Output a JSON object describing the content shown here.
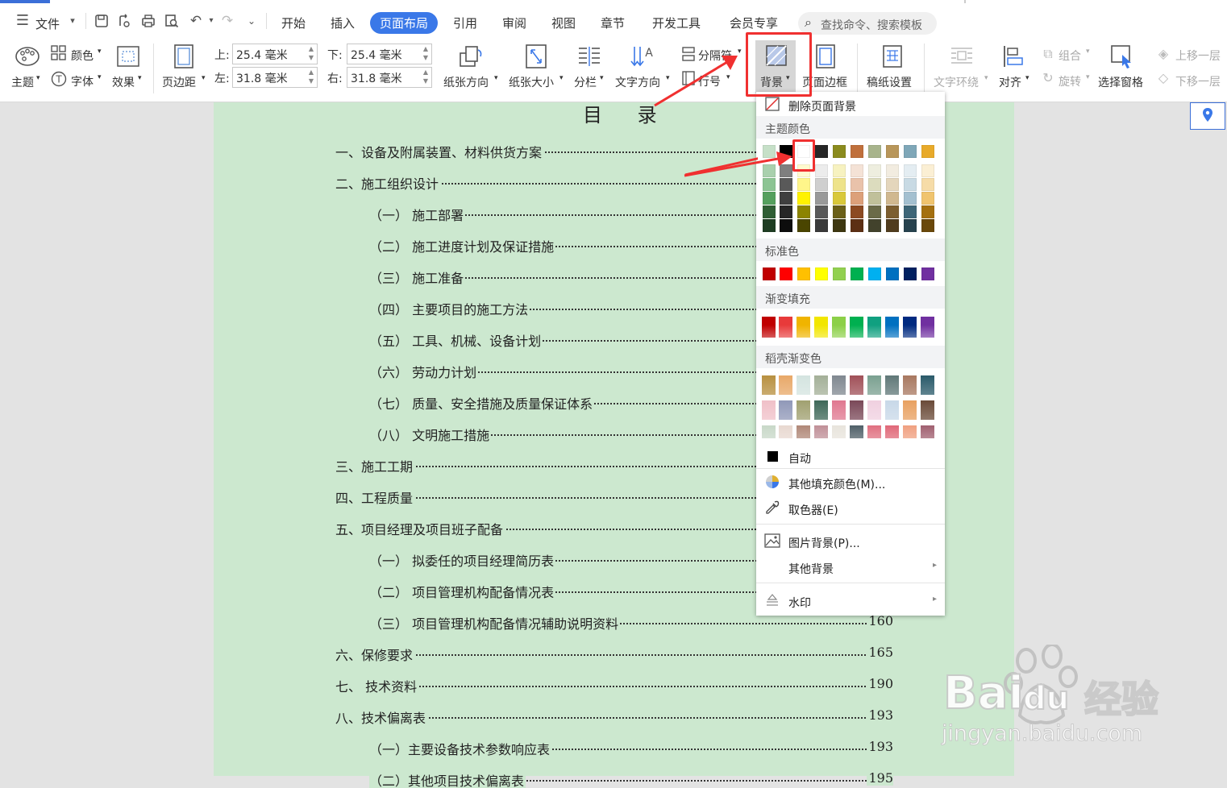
{
  "menubar": {
    "file_label": "文件",
    "tabs": [
      {
        "label": "开始",
        "active": false
      },
      {
        "label": "插入",
        "active": false
      },
      {
        "label": "页面布局",
        "active": true
      },
      {
        "label": "引用",
        "active": false
      },
      {
        "label": "审阅",
        "active": false
      },
      {
        "label": "视图",
        "active": false
      },
      {
        "label": "章节",
        "active": false
      },
      {
        "label": "开发工具",
        "active": false
      },
      {
        "label": "会员专享",
        "active": false
      }
    ],
    "search_placeholder": "查找命令、搜索模板"
  },
  "ribbon": {
    "theme_label": "主题",
    "color_label": "颜色",
    "font_label": "字体",
    "effect_label": "效果",
    "margin_label": "页边距",
    "top_label": "上:",
    "top_value": "25.4 毫米",
    "bottom_label": "下:",
    "bottom_value": "25.4 毫米",
    "left_label": "左:",
    "left_value": "31.8 毫米",
    "right_label": "右:",
    "right_value": "31.8 毫米",
    "orientation_label": "纸张方向",
    "size_label": "纸张大小",
    "columns_label": "分栏",
    "text_dir_label": "文字方向",
    "break_label": "分隔符",
    "line_num_label": "行号",
    "background_label": "背景",
    "border_label": "页面边框",
    "grid_paper_label": "稿纸设置",
    "wrap_label": "文字环绕",
    "align_label": "对齐",
    "group_label": "组合",
    "rotate_label": "旋转",
    "select_pane_label": "选择窗格",
    "bring_forward_label": "上移一层",
    "send_backward_label": "下移一层"
  },
  "document": {
    "title": "目  录",
    "toc": [
      {
        "text": "一、设备及附属装置、材料供货方案",
        "page": "",
        "indent": 0
      },
      {
        "text": "二、施工组织设计",
        "page": "",
        "indent": 0
      },
      {
        "text": "（一）  施工部署",
        "page": "",
        "indent": 1
      },
      {
        "text": "（二）  施工进度计划及保证措施",
        "page": "",
        "indent": 1
      },
      {
        "text": "（三）  施工准备",
        "page": "",
        "indent": 1
      },
      {
        "text": "（四）  主要项目的施工方法",
        "page": "",
        "indent": 1
      },
      {
        "text": "（五）  工具、机械、设备计划",
        "page": "",
        "indent": 1
      },
      {
        "text": "（六）  劳动力计划",
        "page": "",
        "indent": 1
      },
      {
        "text": "（七）  质量、安全措施及质量保证体系",
        "page": "",
        "indent": 1
      },
      {
        "text": "（八）  文明施工措施",
        "page": "",
        "indent": 1
      },
      {
        "text": "三、施工工期",
        "page": "",
        "indent": 0
      },
      {
        "text": "四、工程质量",
        "page": "",
        "indent": 0
      },
      {
        "text": "五、项目经理及项目班子配备",
        "page": "",
        "indent": 0
      },
      {
        "text": "（一）  拟委任的项目经理简历表",
        "page": "",
        "indent": 1
      },
      {
        "text": "（二）  项目管理机构配备情况表",
        "page": "",
        "indent": 1
      },
      {
        "text": "（三）  项目管理机构配备情况辅助说明资料",
        "page": "160",
        "indent": 1
      },
      {
        "text": "六、保修要求",
        "page": "165",
        "indent": 0
      },
      {
        "text": "七、  技术资料",
        "page": "190",
        "indent": 0
      },
      {
        "text": "八、技术偏离表",
        "page": "193",
        "indent": 0
      },
      {
        "text": "（一）主要设备技术参数响应表",
        "page": "193",
        "indent": 1
      },
      {
        "text": "（二）其他项目技术偏离表",
        "page": "195",
        "indent": 1
      }
    ]
  },
  "dropdown": {
    "remove_bg": "删除页面背景",
    "theme_colors_title": "主题颜色",
    "standard_colors_title": "标准色",
    "gradient_title": "渐变填充",
    "docer_gradient_title": "稻壳渐变色",
    "auto_label": "自动",
    "more_colors": "其他填充颜色(M)...",
    "eyedropper": "取色器(E)",
    "picture_bg": "图片背景(P)...",
    "other_bg": "其他背景",
    "watermark": "水印",
    "theme_top_row": [
      "#c6e0c8",
      "#000000",
      "#ffffff",
      "#262626",
      "#8b8b1e",
      "#c0703c",
      "#a8b48c",
      "#b8965a",
      "#7fa7b8",
      "#e8aa2a"
    ],
    "theme_columns": [
      [
        "#a9d0ad",
        "#8cc493",
        "#55a05e",
        "#2f5e34",
        "#1e3d22"
      ],
      [
        "#7f7f7f",
        "#595959",
        "#3f3f3f",
        "#262626",
        "#0d0d0d"
      ],
      [
        "#fffbd0",
        "#fff68a",
        "#fff200",
        "#8c8400",
        "#4a4500"
      ],
      [
        "#ececec",
        "#cfcfcf",
        "#999999",
        "#595959",
        "#3a3a3a"
      ],
      [
        "#f7f2c0",
        "#eee38a",
        "#d9c83a",
        "#6b6018",
        "#3e3710"
      ],
      [
        "#f4e2d6",
        "#e9c2aa",
        "#dca07a",
        "#8c4a22",
        "#5c2f14"
      ],
      [
        "#eeeedf",
        "#dcdcbe",
        "#c0c09a",
        "#6a6a48",
        "#42422c"
      ],
      [
        "#f2ece0",
        "#e4d6bc",
        "#d0b890",
        "#7c5e30",
        "#503c1e"
      ],
      [
        "#e4edf2",
        "#c8dae4",
        "#a4c0d0",
        "#3e6678",
        "#27424e"
      ],
      [
        "#fbefd4",
        "#f6dca8",
        "#f0c46e",
        "#a47010",
        "#6a480a"
      ]
    ],
    "standard_colors": [
      "#c00000",
      "#ff0000",
      "#ffc000",
      "#ffff00",
      "#92d050",
      "#00b050",
      "#00b0f0",
      "#0070c0",
      "#002060",
      "#7030a0"
    ],
    "gradient_colors": [
      "#c00000",
      "#e83a3a",
      "#f0b400",
      "#f2e600",
      "#8cd048",
      "#00b050",
      "#10a080",
      "#0070c0",
      "#002a80",
      "#7030a0"
    ],
    "docer_rows": [
      [
        "#b89040",
        "#e8a868",
        "#d4e4e0",
        "#a4b098",
        "#808890",
        "#a05058",
        "#7aa090",
        "#607878",
        "#a87860",
        "#2a5a6a"
      ],
      [
        "#f0c0c8",
        "#9098b8",
        "#a0a070",
        "#3e6858",
        "#e07890",
        "#7a4858",
        "#f0d0e0",
        "#c8d8e8",
        "#e8a060",
        "#6a4a38"
      ],
      [
        "#c8d8c8",
        "#e8d8d0",
        "#b08878",
        "#c09098",
        "#e8e4dc",
        "#506068",
        "#e07080",
        "#e06878",
        "#f0a080",
        "#a06070"
      ]
    ]
  },
  "watermark": {
    "brand": "Bai",
    "brand2": "du",
    "brand_cn": "经验",
    "url": "jingyan.baidu.com"
  },
  "colors": {
    "accent": "#3a78e8",
    "page_bg": "#cce8cf",
    "highlight_red": "#f03030"
  }
}
